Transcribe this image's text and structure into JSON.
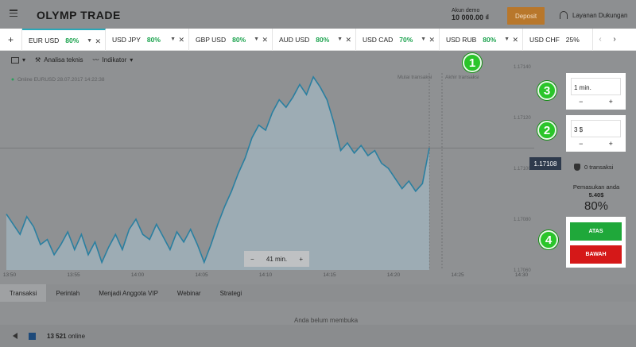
{
  "header": {
    "logo": "OLYMP TRADE",
    "demo_label": "Akun demo",
    "demo_balance": "10 000.00 ₫",
    "deposit_label": "Deposit",
    "support_label": "Layanan Dukungan"
  },
  "tabs": [
    {
      "name": "EUR USD",
      "pct": "80%"
    },
    {
      "name": "USD JPY",
      "pct": "80%"
    },
    {
      "name": "GBP USD",
      "pct": "80%"
    },
    {
      "name": "AUD USD",
      "pct": "80%"
    },
    {
      "name": "USD CAD",
      "pct": "70%"
    },
    {
      "name": "USD RUB",
      "pct": "80%"
    },
    {
      "name": "USD CHF",
      "pct": "25%"
    }
  ],
  "toolbar": {
    "technical": "Analisa teknis",
    "indicator": "Indikator"
  },
  "chart": {
    "info": "Online EURUSD 28.07.2017 14:22:38",
    "marker_start": "Mulai transaksi",
    "marker_end": "Akhir transaksi",
    "current_price": "1.17108",
    "zoom_label": "41 min.",
    "zoom_minus": "−",
    "zoom_plus": "+"
  },
  "chart_data": {
    "type": "area",
    "x_ticks": [
      "13:50",
      "13:55",
      "14:00",
      "14:05",
      "14:10",
      "14:15",
      "14:20",
      "14:25",
      "14:30"
    ],
    "y_ticks": [
      "1.17140",
      "1.17120",
      "1.17100",
      "1.17080",
      "1.17060"
    ],
    "ylim": [
      1.1706,
      1.1714
    ],
    "current_price": 1.17108,
    "line_color": "#2a7fa0",
    "fill_color": "#a9c2cf",
    "series": [
      1.17082,
      1.17078,
      1.17074,
      1.17081,
      1.17077,
      1.1707,
      1.17072,
      1.17066,
      1.1707,
      1.17075,
      1.17068,
      1.17074,
      1.17066,
      1.17071,
      1.17063,
      1.17069,
      1.17074,
      1.17068,
      1.17076,
      1.1708,
      1.17074,
      1.17072,
      1.17078,
      1.17073,
      1.17068,
      1.17075,
      1.17071,
      1.17076,
      1.1707,
      1.17063,
      1.1707,
      1.17078,
      1.17085,
      1.17091,
      1.17098,
      1.17104,
      1.17112,
      1.17117,
      1.17115,
      1.17122,
      1.17127,
      1.17124,
      1.17128,
      1.17133,
      1.17129,
      1.17136,
      1.17132,
      1.17127,
      1.17118,
      1.17107,
      1.1711,
      1.17106,
      1.17109,
      1.17105,
      1.17107,
      1.17102,
      1.171,
      1.17096,
      1.17092,
      1.17095,
      1.17091,
      1.17094,
      1.17108
    ]
  },
  "panel": {
    "time_value": "1 min.",
    "amount_value": "3 $",
    "minus": "−",
    "plus": "+",
    "transactions": "0 transaksi",
    "income_label": "Pemasukan anda",
    "income_value": "5.40$",
    "income_pct": "80%",
    "up_label": "ATAS",
    "down_label": "BAWAH"
  },
  "badges": [
    "1",
    "2",
    "3",
    "4"
  ],
  "bottom_tabs": [
    "Transaksi",
    "Perintah",
    "Menjadi Anggota VIP",
    "Webinar",
    "Strategi"
  ],
  "empty_message": "Anda belum membuka",
  "footer": {
    "online_count": "13 521",
    "online_label": "online"
  }
}
